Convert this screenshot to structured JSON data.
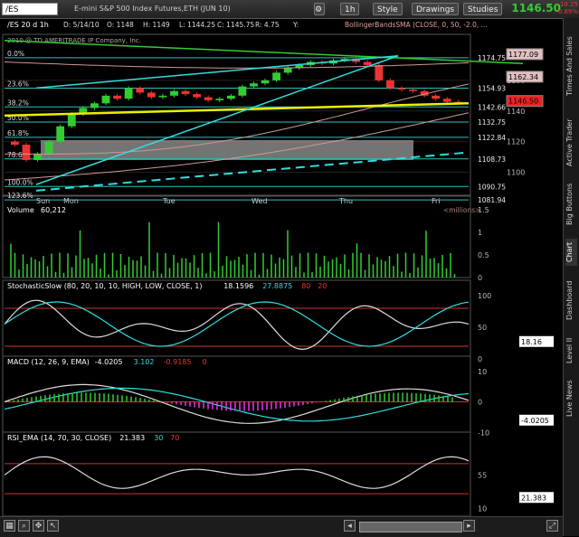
{
  "toolbar": {
    "symbol": "/ES",
    "timeframe": "1h",
    "style_label": "Style",
    "drawings_label": "Drawings",
    "studies_label": "Studies",
    "last_price": "1146.50",
    "change_top": "-10.25",
    "change_bottom": "-0.89%"
  },
  "side_tabs": [
    "Times And Sales",
    "Active Trader",
    "Big Buttons",
    "Chart",
    "Dashboard",
    "Level II",
    "Live News"
  ],
  "price_panel": {
    "title": "/ES 20 d 1h",
    "date_label": "D: 5/14/10",
    "ohlc": [
      "O: 1148",
      "H: 1149",
      "L: 1144.25",
      "C: 1145.75",
      "R: 4.75",
      "Y:"
    ],
    "study": "BollingerBandsSMA (CLOSE, 0, 50, -2.0, ...",
    "copyright": "2010 @ TD AMERITRADE IP Company, Inc.",
    "description": "E-mini S&P 500 Index Futures,ETH (JUN 10)"
  },
  "chart_data": [
    {
      "type": "candlestick",
      "name": "price",
      "x": [
        "Sun",
        "Mon",
        "Tue",
        "Wed",
        "Thu",
        "Fri"
      ],
      "ylim": [
        1085,
        1190
      ],
      "ticks": [
        1100,
        1120,
        1140,
        1160
      ],
      "close": [
        1118,
        1108,
        1112,
        1120,
        1130,
        1138,
        1142,
        1145,
        1150,
        1148,
        1155,
        1152,
        1149,
        1150,
        1153,
        1151,
        1149,
        1147,
        1148,
        1150,
        1156,
        1158,
        1160,
        1165,
        1168,
        1170,
        1172,
        1171,
        1173,
        1174,
        1172,
        1170,
        1160,
        1155,
        1154,
        1153,
        1150,
        1148,
        1146,
        1145.75
      ],
      "fib_levels": [
        {
          "label": "0.0%",
          "value": 1174.75
        },
        {
          "label": "23.6%",
          "value": 1154.93
        },
        {
          "label": "38.2%",
          "value": 1142.66
        },
        {
          "label": "50.0%",
          "value": 1132.75
        },
        {
          "label": "61.8%",
          "value": 1122.84
        },
        {
          "label": "78.6%",
          "value": 1108.73
        },
        {
          "label": "100.0%",
          "value": 1090.75
        },
        {
          "label": "123.6%",
          "value": 1081.94
        }
      ],
      "price_boxes": [
        {
          "label": "1177.09",
          "value": 1177.09,
          "color": "#e0c0c0"
        },
        {
          "label": "1162.34",
          "value": 1162.34,
          "color": "#e0c0c0"
        },
        {
          "label": "1146.50",
          "value": 1146.5,
          "color": "#ee2222"
        }
      ]
    },
    {
      "type": "bar",
      "name": "Volume",
      "value_label": "60,212",
      "units": "<millions>",
      "ylim": [
        0,
        1.6
      ],
      "ticks": [
        0,
        0.5,
        1,
        1.5
      ]
    },
    {
      "type": "line",
      "name": "StochasticSlow (80, 20, 10, 10, HIGH, LOW, CLOSE, 1)",
      "values_labels": [
        "18.1596",
        "27.8875",
        "80",
        "20"
      ],
      "ylim": [
        0,
        110
      ],
      "ticks": [
        0,
        50,
        100
      ],
      "readout": "18.16"
    },
    {
      "type": "line",
      "name": "MACD (12, 26, 9, EMA)",
      "values_labels": [
        "-4.0205",
        "3.102",
        "-0.9185",
        "0"
      ],
      "ylim": [
        -12,
        12
      ],
      "ticks": [
        -10,
        0,
        10
      ],
      "readout": "-4.0205"
    },
    {
      "type": "line",
      "name": "RSI_EMA (14, 70, 30, CLOSE)",
      "values_labels": [
        "21.383",
        "30",
        "70"
      ],
      "ylim": [
        0,
        100
      ],
      "ticks": [
        10,
        55
      ],
      "readout": "21.383"
    }
  ]
}
